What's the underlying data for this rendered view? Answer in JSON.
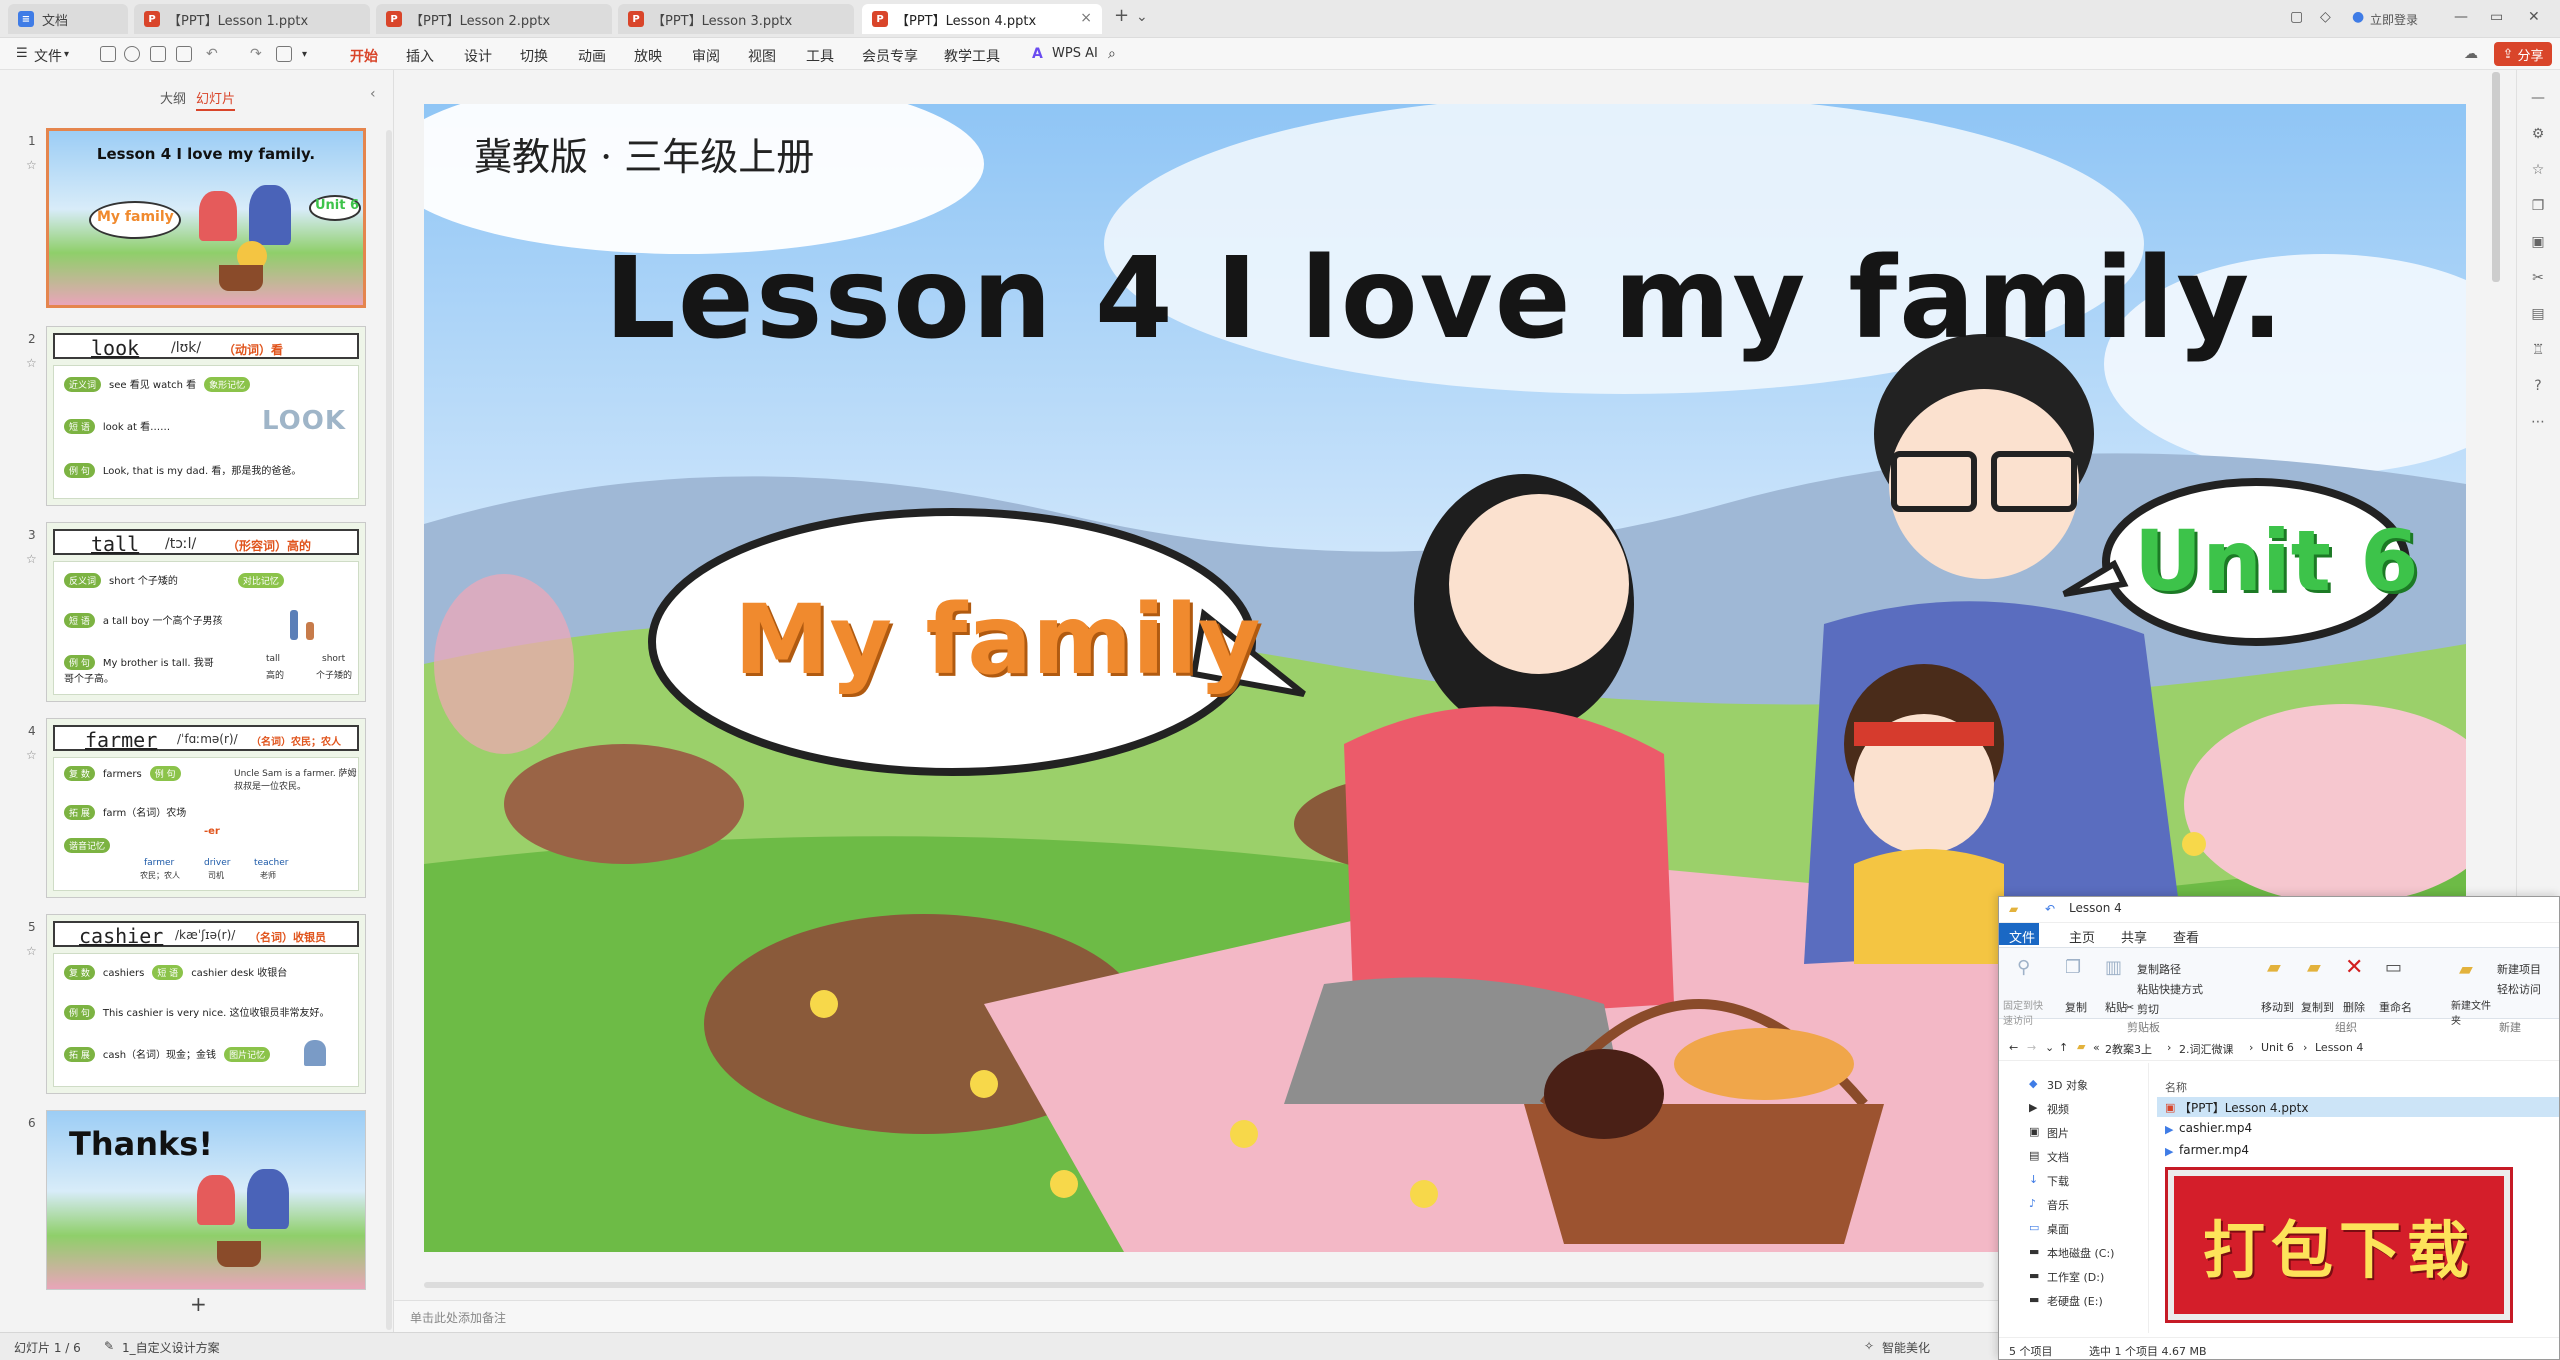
{
  "tabs": [
    {
      "label": "文档",
      "type": "doc"
    },
    {
      "label": "【PPT】Lesson 1.pptx",
      "type": "ppt"
    },
    {
      "label": "【PPT】Lesson 2.pptx",
      "type": "ppt"
    },
    {
      "label": "【PPT】Lesson 3.pptx",
      "type": "ppt"
    },
    {
      "label": "【PPT】Lesson 4.pptx",
      "type": "ppt",
      "active": true
    }
  ],
  "titlebar": {
    "login": "立即登录",
    "share": "分享"
  },
  "menu": {
    "file": "文件",
    "items": [
      "开始",
      "插入",
      "设计",
      "切换",
      "动画",
      "放映",
      "审阅",
      "视图",
      "工具",
      "会员专享",
      "教学工具"
    ],
    "wps_ai": "WPS AI"
  },
  "leftpanel": {
    "tabs": [
      "大纲",
      "幻灯片"
    ],
    "add_symbol": "+",
    "slides": [
      {
        "num": "1",
        "title": "Lesson 4  I love my family.",
        "bubble_left": "My family",
        "bubble_right": "Unit 6"
      },
      {
        "num": "2",
        "word": "look",
        "phon": "/lʊk/",
        "pos": "（动词）看",
        "rows": [
          {
            "tag": "近义词",
            "text": "see 看见    watch 看",
            "tag2": "象形记忆"
          },
          {
            "tag": "短 语",
            "text": "look at 看……"
          },
          {
            "tag": "例 句",
            "text": "Look, that is my dad. 看，那是我的爸爸。"
          }
        ],
        "art": "LOOK"
      },
      {
        "num": "3",
        "word": "tall",
        "phon": "/tɔːl/",
        "pos": "（形容词）高的",
        "rows": [
          {
            "tag": "反义词",
            "text": "short 个子矮的",
            "tag2": "对比记忆"
          },
          {
            "tag": "短 语",
            "text": "a tall boy 一个高个子男孩"
          },
          {
            "tag": "例 句",
            "text": "My brother is tall.  我哥哥个子高。"
          }
        ],
        "extra": [
          "tall",
          "高的",
          "short",
          "个子矮的"
        ]
      },
      {
        "num": "4",
        "word": "farmer",
        "phon": "/ˈfɑːmə(r)/",
        "pos": "（名词）农民；农人",
        "rows": [
          {
            "tag": "复 数",
            "text": "farmers",
            "tag2": "例 句",
            "text2": "Uncle Sam is a farmer. 萨姆叔叔是一位农民。"
          },
          {
            "tag": "拓 展",
            "text": "farm（名词）农场"
          },
          {
            "tag": "谐音记忆",
            "text": "-er"
          }
        ],
        "extra": [
          "farmer",
          "农民；农人",
          "driver",
          "司机",
          "teacher",
          "老师"
        ]
      },
      {
        "num": "5",
        "word": "cashier",
        "phon": "/kæˈʃɪə(r)/",
        "pos": "（名词）收银员",
        "rows": [
          {
            "tag": "复 数",
            "text": "cashiers",
            "tag2": "短 语",
            "text2": "cashier desk 收银台"
          },
          {
            "tag": "例 句",
            "text": "This cashier is very nice. 这位收银员非常友好。"
          },
          {
            "tag": "拓 展",
            "text": "cash（名词）现金；金钱",
            "tag2": "图片记忆"
          }
        ]
      },
      {
        "num": "6",
        "title": "Thanks!"
      }
    ]
  },
  "slide": {
    "edition": "冀教版 · 三年级上册",
    "title": "Lesson 4  I love my family.",
    "bubble_left": "My family",
    "bubble_right": "Unit 6"
  },
  "notes_placeholder": "单击此处添加备注",
  "status": {
    "slide_info": "幻灯片 1 / 6",
    "theme": "1_自定义设计方案",
    "smart": "智能美化"
  },
  "explorer": {
    "title": "Lesson 4",
    "ribbon_tabs": [
      "文件",
      "主页",
      "共享",
      "查看"
    ],
    "ribbon": {
      "pin": "固定到快速访问",
      "copy": "复制",
      "paste": "粘贴",
      "copy_path": "复制路径",
      "paste_shortcut": "粘贴快捷方式",
      "cut": "剪切",
      "clipboard": "剪贴板",
      "move_to": "移动到",
      "copy_to": "复制到",
      "delete": "删除",
      "rename": "重命名",
      "organize": "组织",
      "new_folder": "新建文件夹",
      "new_item": "新建项目",
      "easy_access": "轻松访问",
      "new_group": "新建"
    },
    "breadcrumb": [
      "2教案3上",
      "2.词汇微课",
      "Unit 6",
      "Lesson 4"
    ],
    "breadcrumb_prefix": "«",
    "column_name": "名称",
    "nav": [
      "3D 对象",
      "视频",
      "图片",
      "文档",
      "下载",
      "音乐",
      "桌面",
      "本地磁盘 (C:)",
      "工作室 (D:)",
      "老硬盘 (E:)"
    ],
    "files": [
      "【PPT】Lesson 4.pptx",
      "cashier.mp4",
      "farmer.mp4"
    ],
    "status_items": "5 个项目",
    "status_selected": "选中 1 个项目  4.67 MB"
  },
  "download_banner": "打包下载",
  "colors": {
    "accent": "#d9452a",
    "bubble_orange": "#f08a2e",
    "bubble_green": "#3dc34a",
    "banner_red": "#d41e2a",
    "banner_text": "#fde35a"
  }
}
